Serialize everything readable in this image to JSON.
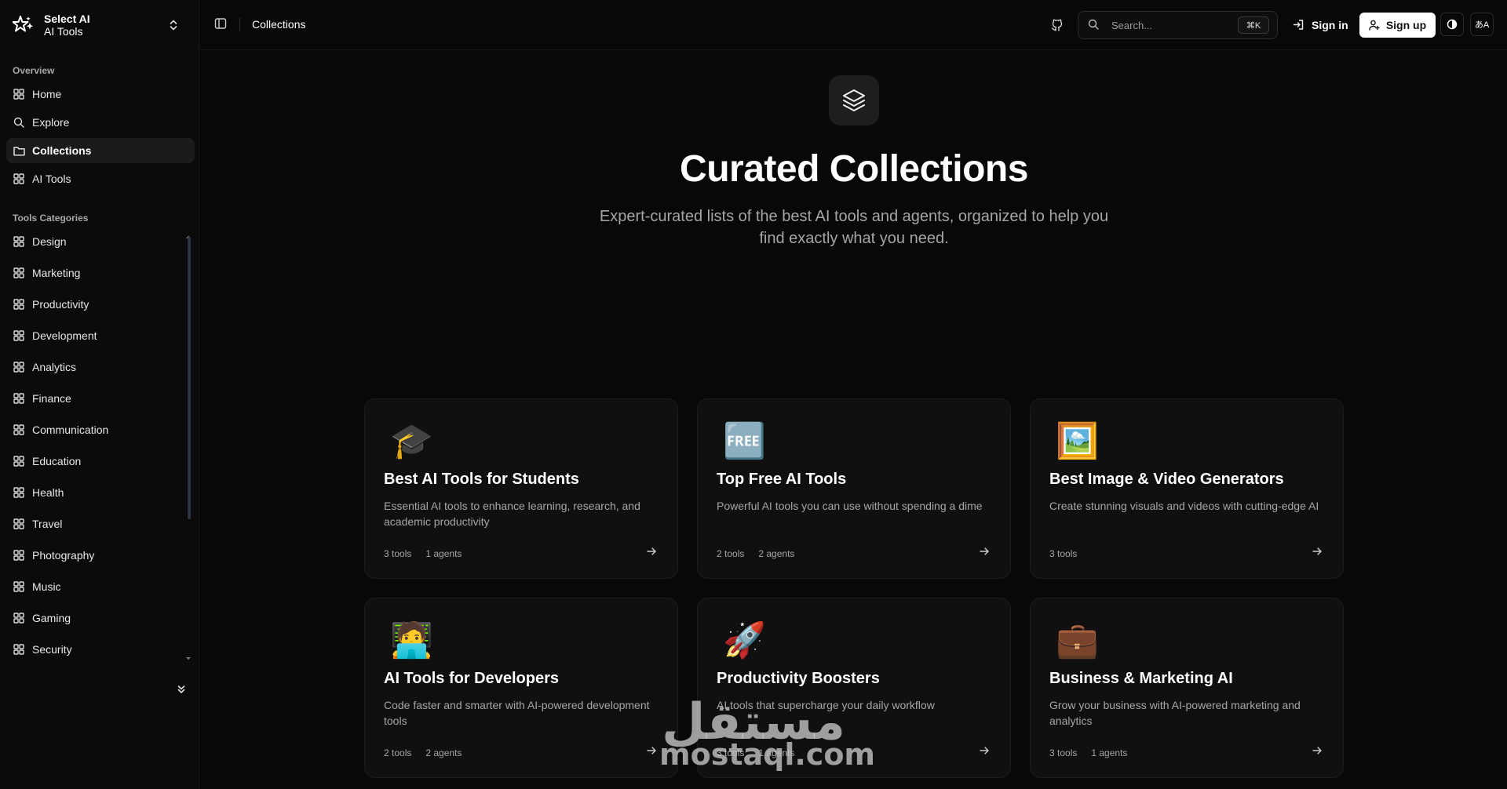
{
  "brand": {
    "line1": "Select AI",
    "line2": "AI Tools"
  },
  "sidebar": {
    "overview_label": "Overview",
    "overview_items": [
      {
        "label": "Home",
        "icon": "grid-icon"
      },
      {
        "label": "Explore",
        "icon": "search-icon"
      },
      {
        "label": "Collections",
        "icon": "folder-icon",
        "active": true
      },
      {
        "label": "AI Tools",
        "icon": "grid-icon"
      }
    ],
    "categories_label": "Tools Categories",
    "categories": [
      "Design",
      "Marketing",
      "Productivity",
      "Development",
      "Analytics",
      "Finance",
      "Communication",
      "Education",
      "Health",
      "Travel",
      "Photography",
      "Music",
      "Gaming",
      "Security"
    ]
  },
  "header": {
    "title": "Collections",
    "search_placeholder": "Search...",
    "search_shortcut": "⌘K",
    "signin_label": "Sign in",
    "signup_label": "Sign up",
    "lang_label": "あA"
  },
  "hero": {
    "title": "Curated Collections",
    "subtitle": "Expert-curated lists of the best AI tools and agents, organized to help you find exactly what you need."
  },
  "collections": [
    {
      "emoji": "🎓",
      "title": "Best AI Tools for Students",
      "description": "Essential AI tools to enhance learning, research, and academic productivity",
      "tools": "3 tools",
      "agents": "1 agents"
    },
    {
      "emoji": "🆓",
      "title": "Top Free AI Tools",
      "description": "Powerful AI tools you can use without spending a dime",
      "tools": "2 tools",
      "agents": "2 agents"
    },
    {
      "emoji": "🖼️",
      "title": "Best Image & Video Generators",
      "description": "Create stunning visuals and videos with cutting-edge AI",
      "tools": "3 tools",
      "agents": ""
    },
    {
      "emoji": "🧑‍💻",
      "title": "AI Tools for Developers",
      "description": "Code faster and smarter with AI-powered development tools",
      "tools": "2 tools",
      "agents": "2 agents"
    },
    {
      "emoji": "🚀",
      "title": "Productivity Boosters",
      "description": "AI tools that supercharge your daily workflow",
      "tools": "3 tools",
      "agents": "1 agents"
    },
    {
      "emoji": "💼",
      "title": "Business & Marketing AI",
      "description": "Grow your business with AI-powered marketing and analytics",
      "tools": "3 tools",
      "agents": "1 agents"
    }
  ],
  "watermark": {
    "arabic": "مستقل",
    "latin": "mostaql.com"
  }
}
